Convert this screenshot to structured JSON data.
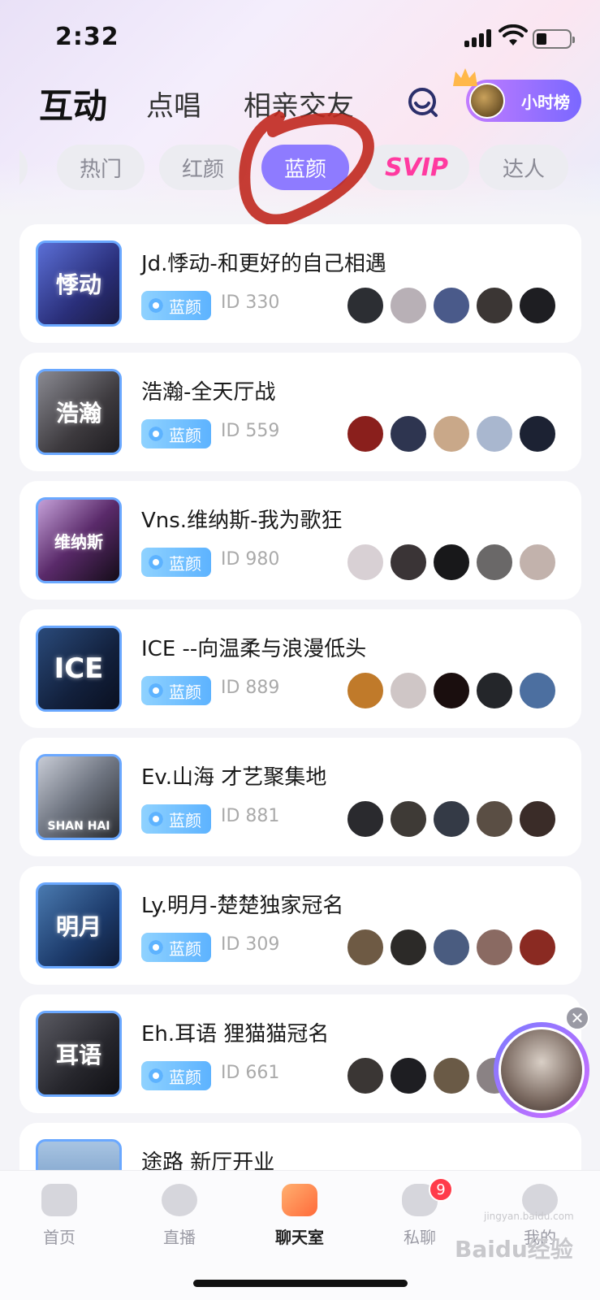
{
  "status_bar": {
    "time": "2:32"
  },
  "top_nav": {
    "tabs": [
      {
        "label": "互动",
        "active": true
      },
      {
        "label": "点唱",
        "active": false
      },
      {
        "label": "相亲交友",
        "active": false
      }
    ],
    "rank_button": "小时榜"
  },
  "categories": [
    {
      "label": "热门",
      "active": false
    },
    {
      "label": "红颜",
      "active": false
    },
    {
      "label": "蓝颜",
      "active": true
    },
    {
      "label": "SVIP",
      "active": false
    },
    {
      "label": "达人",
      "active": false
    }
  ],
  "rooms": [
    {
      "name": "Jd.悸动-和更好的自己相遇",
      "tag": "蓝颜",
      "id": "ID 330",
      "cover_text": "悸动"
    },
    {
      "name": "浩瀚-全天厅战",
      "tag": "蓝颜",
      "id": "ID 559",
      "cover_text": "浩瀚"
    },
    {
      "name": "Vns.维纳斯-我为歌狂",
      "tag": "蓝颜",
      "id": "ID 980",
      "cover_text": "维纳斯"
    },
    {
      "name": "ICE --向温柔与浪漫低头",
      "tag": "蓝颜",
      "id": "ID 889",
      "cover_text": "ICE"
    },
    {
      "name": "Ev.山海  才艺聚集地",
      "tag": "蓝颜",
      "id": "ID 881",
      "cover_text": "SHAN HAI"
    },
    {
      "name": "Ly.明月-楚楚独家冠名",
      "tag": "蓝颜",
      "id": "ID 309",
      "cover_text": "明月"
    },
    {
      "name": "Eh.耳语  狸猫猫冠名",
      "tag": "蓝颜",
      "id": "ID 661",
      "cover_text": "耳语"
    },
    {
      "name": "途路  新厅开业",
      "tag": "",
      "id": "",
      "cover_text": ""
    }
  ],
  "bottom_nav": [
    {
      "label": "首页",
      "active": false
    },
    {
      "label": "直播",
      "active": false
    },
    {
      "label": "聊天室",
      "active": true
    },
    {
      "label": "私聊",
      "active": false,
      "badge": "9"
    },
    {
      "label": "我的",
      "active": false
    }
  ],
  "watermark": "Baidu经验",
  "watermark_sub": "jingyan.baidu.com",
  "colors": {
    "accent_purple": "#8e7bff",
    "svip_pink": "#ff3aa0",
    "tag_blue": "#5db3ff",
    "annotation_red": "#c0281e"
  }
}
